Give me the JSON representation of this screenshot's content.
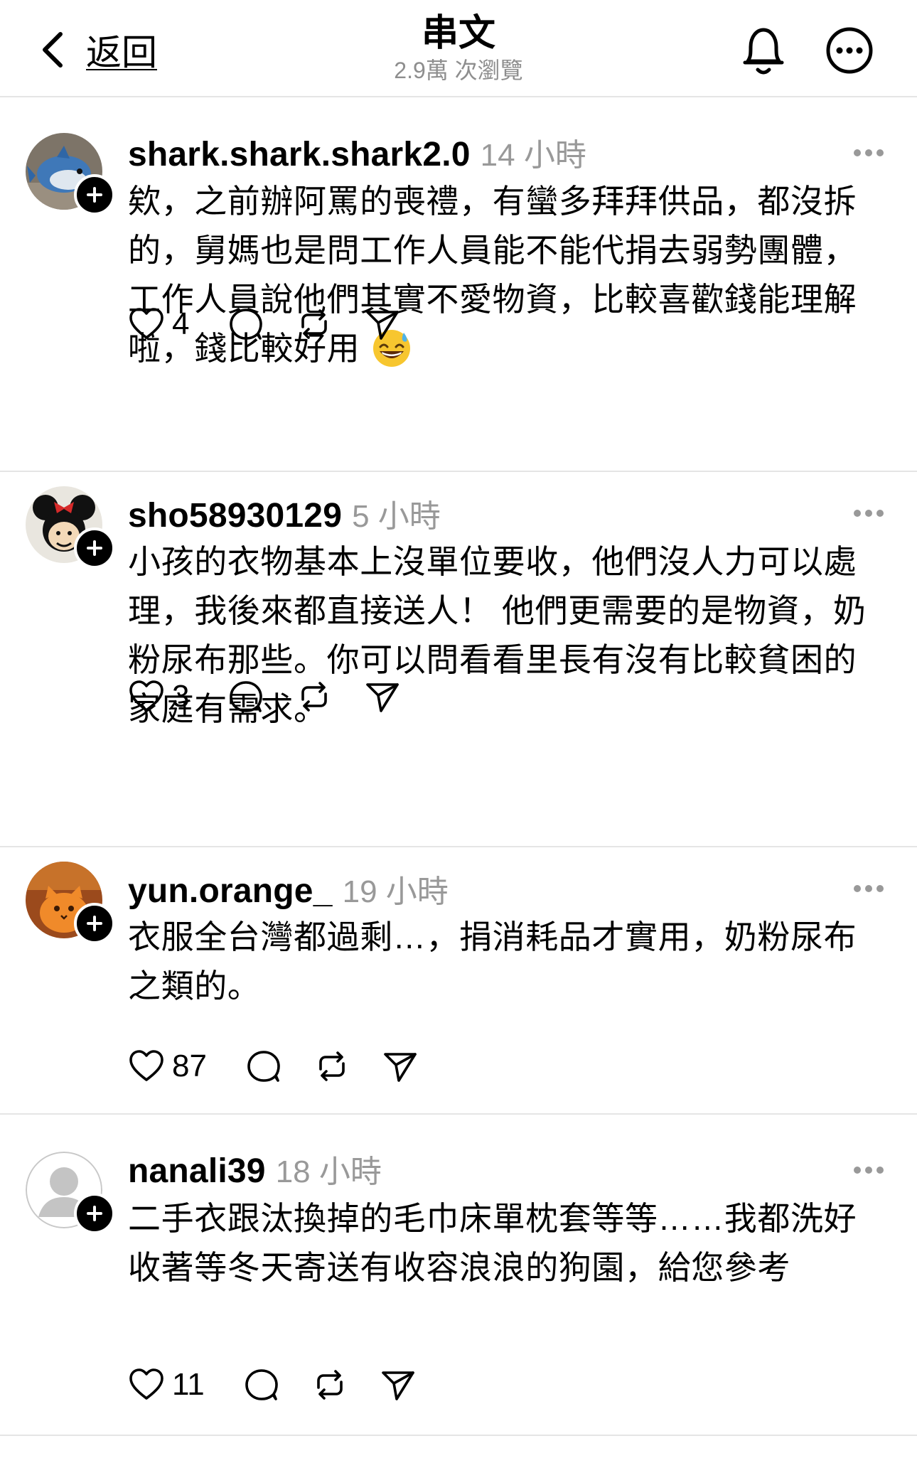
{
  "header": {
    "back_label": "返回",
    "title": "串文",
    "views": "2.9萬 次瀏覽"
  },
  "posts": [
    {
      "username": "shark.shark.shark2.0",
      "time": "14 小時",
      "text": "欸，之前辦阿罵的喪禮，有蠻多拜拜供品，都沒拆的，舅媽也是問工作人員能不能代捐去弱勢團體，工作人員說他們其實不愛物資，比較喜歡錢能理解啦，錢比較好用",
      "emoji": "grinning-face-with-sweat",
      "likes": "4"
    },
    {
      "username": "sho58930129",
      "time": "5 小時",
      "text": "小孩的衣物基本上沒單位要收，他們沒人力可以處理，我後來都直接送人！  他們更需要的是物資，奶粉尿布那些。你可以問看看里長有沒有比較貧困的家庭有需求。",
      "likes": "3"
    },
    {
      "username": "yun.orange_",
      "time": "19 小時",
      "text": "衣服全台灣都過剩…，捐消耗品才實用，奶粉尿布之類的。",
      "likes": "87"
    },
    {
      "username": "nanali39",
      "time": "18 小時",
      "text": "二手衣跟汰換掉的毛巾床單枕套等等……我都洗好收著等冬天寄送有收容浪浪的狗園，給您參考",
      "likes": "11"
    }
  ]
}
